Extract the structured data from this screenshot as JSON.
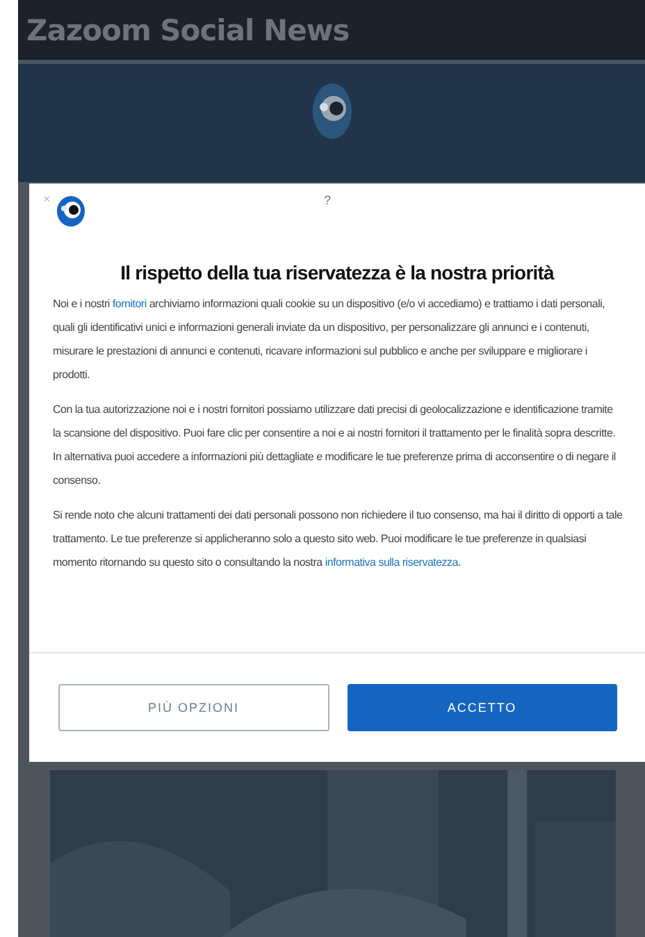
{
  "header": {
    "title": "Zazoom Social News"
  },
  "dialog": {
    "close": "×",
    "help": "?",
    "title": "Il rispetto della tua riservatezza è la nostra priorità",
    "paragraphs": [
      [
        {
          "text": "Noi e i nostri "
        },
        {
          "text": "fornitori",
          "kind": "link"
        },
        {
          "text": " archiviamo informazioni quali cookie su un dispositivo (e/o vi accediamo) e trattiamo i dati personali, quali gli identificativi unici e informazioni generali inviate da un dispositivo, per personalizzare gli annunci e i contenuti, misurare le prestazioni di annunci e contenuti, ricavare informazioni sul pubblico e anche per sviluppare e migliorare i prodotti."
        }
      ],
      [
        {
          "text": "Con la tua autorizzazione noi e i nostri fornitori possiamo utilizzare dati precisi di geolocalizzazione e identificazione tramite la scansione del dispositivo. Puoi fare clic per consentire a noi e ai nostri fornitori il trattamento per le finalità sopra descritte. In alternativa puoi accedere a informazioni più dettagliate e modificare le tue preferenze prima di acconsentire o di negare il consenso."
        }
      ],
      [
        {
          "text": "Si rende noto che alcuni trattamenti dei dati personali possono non richiedere il tuo consenso, ma hai il diritto di opporti a tale trattamento. Le tue preferenze si applicheranno solo a questo sito web. Puoi modificare le tue preferenze in qualsiasi momento ritornando su questo sito o consultando la nostra "
        },
        {
          "text": "informativa sulla riservatezza",
          "kind": "link"
        },
        {
          "text": "."
        }
      ]
    ],
    "buttons": [
      {
        "label": "PIÙ OPZIONI",
        "kind": "secondary"
      },
      {
        "label": "ACCETTO",
        "kind": "primary"
      }
    ]
  }
}
